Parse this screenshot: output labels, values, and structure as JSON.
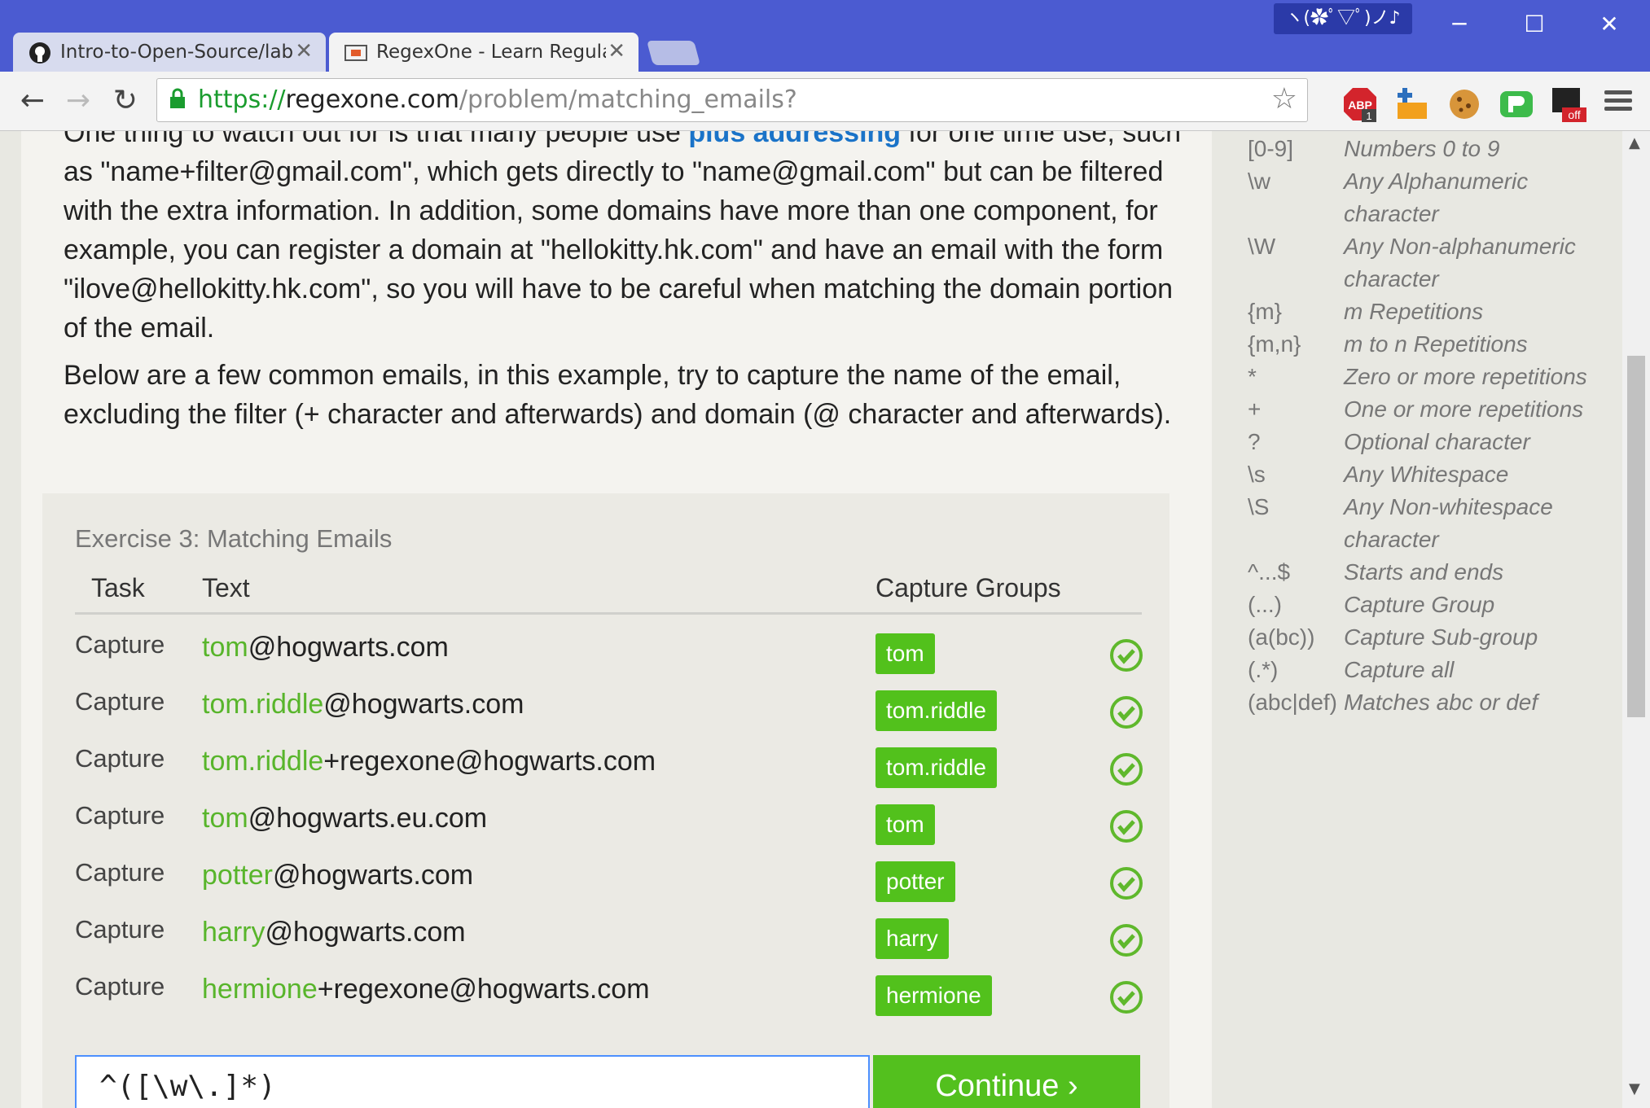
{
  "browser": {
    "kaomoji": "ヽ(✿ﾟ▽ﾟ)ノ♪",
    "window_buttons": {
      "minimize": "─",
      "maximize": "☐",
      "close": "✕"
    },
    "tabs": [
      {
        "title": "Intro-to-Open-Source/lab",
        "close": "✕"
      },
      {
        "title": "RegexOne - Learn Regular",
        "close": "✕"
      }
    ],
    "nav": {
      "back": "←",
      "forward": "→",
      "reload": "↻"
    },
    "url": {
      "protocol": "https://",
      "host": "regexone.com",
      "path": "/problem/matching_emails?"
    },
    "star": "☆"
  },
  "article": {
    "para1_a": "One thing to watch out for is that many people use ",
    "para1_link": "plus addressing",
    "para1_b": " for one time use, such as \"name+filter@gmail.com\", which gets directly to \"name@gmail.com\" but can be filtered with the extra information. In addition, some domains have more than one component, for example, you can register a domain at \"hellokitty.hk.com\" and have an email with the form \"ilove@hellokitty.hk.com\", so you will have to be careful when matching the domain portion of the email.",
    "para2": "Below are a few common emails, in this example, try to capture the name of the email, excluding the filter (+ character and afterwards) and domain (@ character and afterwards)."
  },
  "exercise": {
    "title": "Exercise 3: Matching Emails",
    "headers": {
      "task": "Task",
      "text": "Text",
      "groups": "Capture Groups"
    },
    "rows": [
      {
        "task": "Capture",
        "hl": "tom",
        "rest": "@hogwarts.com",
        "group": "tom"
      },
      {
        "task": "Capture",
        "hl": "tom.riddle",
        "rest": "@hogwarts.com",
        "group": "tom.riddle"
      },
      {
        "task": "Capture",
        "hl": "tom.riddle",
        "rest": "+regexone@hogwarts.com",
        "group": "tom.riddle"
      },
      {
        "task": "Capture",
        "hl": "tom",
        "rest": "@hogwarts.eu.com",
        "group": "tom"
      },
      {
        "task": "Capture",
        "hl": "potter",
        "rest": "@hogwarts.com",
        "group": "potter"
      },
      {
        "task": "Capture",
        "hl": "harry",
        "rest": "@hogwarts.com",
        "group": "harry"
      },
      {
        "task": "Capture",
        "hl": "hermione",
        "rest": "+regexone@hogwarts.com",
        "group": "hermione"
      }
    ],
    "answer_value": "^([\\w\\.]*)",
    "continue_label": "Continue ›"
  },
  "cheatsheet": [
    {
      "key": "[0-9]",
      "desc": "Numbers 0 to 9"
    },
    {
      "key": "\\w",
      "desc": "Any Alphanumeric character"
    },
    {
      "key": "\\W",
      "desc": "Any Non-alphanumeric character"
    },
    {
      "key": "{m}",
      "desc": "m Repetitions"
    },
    {
      "key": "{m,n}",
      "desc": "m to n Repetitions"
    },
    {
      "key": "*",
      "desc": "Zero or more repetitions"
    },
    {
      "key": "+",
      "desc": "One or more repetitions"
    },
    {
      "key": "?",
      "desc": "Optional character"
    },
    {
      "key": "\\s",
      "desc": "Any Whitespace"
    },
    {
      "key": "\\S",
      "desc": "Any Non-whitespace character"
    },
    {
      "key": "^...$",
      "desc": "Starts and ends"
    },
    {
      "key": "(...)",
      "desc": "Capture Group"
    },
    {
      "key": "(a(bc))",
      "desc": "Capture Sub-group"
    },
    {
      "key": "(.*)",
      "desc": "Capture all"
    },
    {
      "key": "(abc|def)",
      "desc": "Matches abc or def"
    }
  ],
  "colors": {
    "accent_green": "#53c01e",
    "link_blue": "#1a73c8",
    "chrome_blue": "#4b5bd1"
  }
}
